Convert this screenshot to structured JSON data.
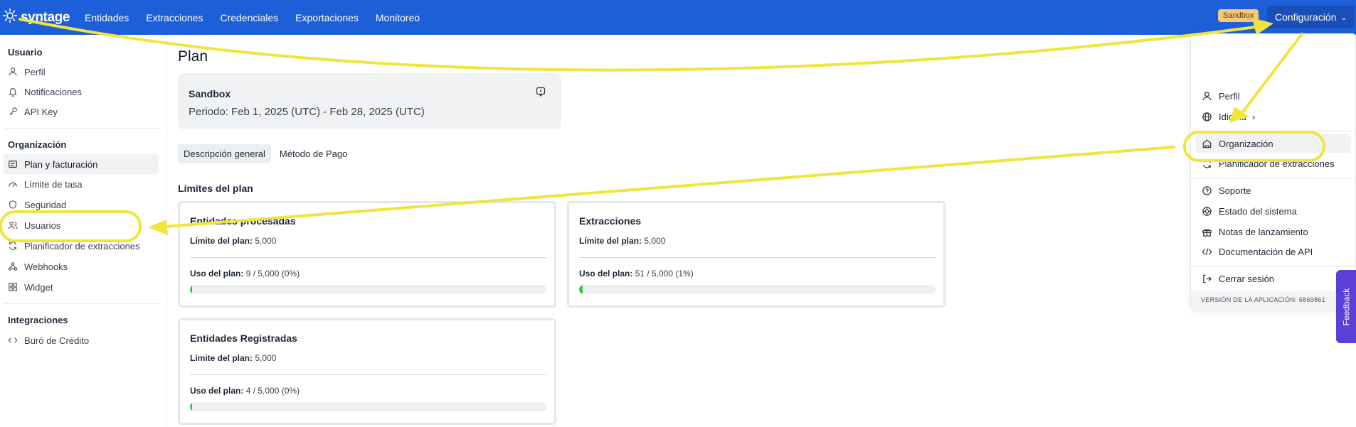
{
  "topbar": {
    "brand": "syntage",
    "nav": [
      "Entidades",
      "Extracciones",
      "Credenciales",
      "Exportaciones",
      "Monitoreo"
    ],
    "env_badge": "Sandbox",
    "config_label": "Configuración"
  },
  "sidebar": {
    "sections": [
      {
        "title": "Usuario",
        "items": [
          "Perfil",
          "Notificaciones",
          "API Key"
        ]
      },
      {
        "title": "Organización",
        "items": [
          "Plan y facturación",
          "Límite de tasa",
          "Seguridad",
          "Usuarios",
          "Planificador de extracciones",
          "Webhooks",
          "Widget"
        ]
      },
      {
        "title": "Integraciones",
        "items": [
          "Buró de Crédito"
        ]
      }
    ],
    "active_item": "Plan y facturación"
  },
  "main": {
    "title": "Plan",
    "plan": {
      "name": "Sandbox",
      "period": "Periodo: Feb 1, 2025 (UTC) - Feb 28, 2025 (UTC)"
    },
    "tabs": [
      "Descripción general",
      "Método de Pago"
    ],
    "active_tab": "Descripción general",
    "limits_title": "Límites del plan",
    "limit_label": "Límite del plan:",
    "usage_label": "Uso del plan:",
    "cards": [
      {
        "title": "Entidades procesadas",
        "limit": "5,000",
        "usage": "9 / 5,000 (0%)",
        "fraction": 0.002
      },
      {
        "title": "Extracciones",
        "limit": "5,000",
        "usage": "51 / 5,000 (1%)",
        "fraction": 0.01
      },
      {
        "title": "Entidades Registradas",
        "limit": "5,000",
        "usage": "4 / 5,000 (0%)",
        "fraction": 0.001
      }
    ]
  },
  "dropdown": {
    "items": [
      "Perfil",
      "Idioma",
      "Organización",
      "Planificador de extracciones",
      "Soporte",
      "Estado del sistema",
      "Notas de lanzamiento",
      "Documentación de API",
      "Cerrar sesión"
    ],
    "active": "Organización",
    "version": "VERSIÓN DE LA APLICACIÓN: 6869861"
  },
  "feedback_label": "Feedback",
  "colors": {
    "nav_bg": "#1d5fd8",
    "badge": "#f5c87a",
    "progress": "#46c03f",
    "annotation": "#f0e53c",
    "feedback": "#5b3fd6"
  }
}
